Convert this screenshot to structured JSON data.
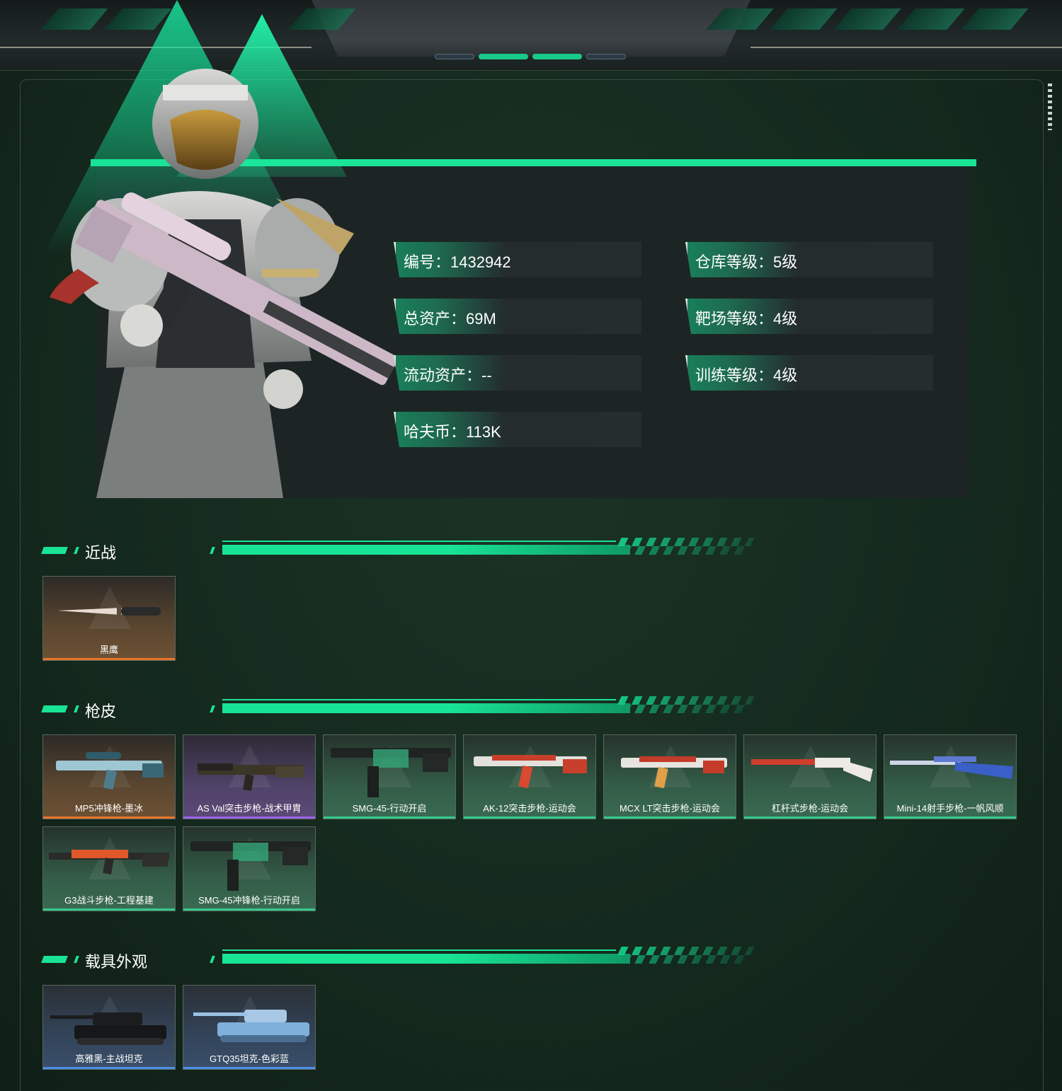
{
  "colors": {
    "accent": "#19e495",
    "rarity_orange": "#e8742a",
    "rarity_purple": "#9b62e6",
    "rarity_green": "#35c98a",
    "rarity_blue": "#4c8fe6"
  },
  "profile": {
    "stats": [
      {
        "label": "编号：1432942"
      },
      {
        "label": "仓库等级：5级"
      },
      {
        "label": "总资产：69M"
      },
      {
        "label": "靶场等级：4级"
      },
      {
        "label": "流动资产：--"
      },
      {
        "label": "训练等级：4级"
      },
      {
        "label": "哈夫币：113K"
      }
    ]
  },
  "sections": {
    "melee": {
      "title": "近战",
      "items": [
        {
          "name": "黑鹰",
          "rarity": "orange",
          "icon": "knife-icon"
        }
      ]
    },
    "gun_skins": {
      "title": "枪皮",
      "items": [
        {
          "name": "MP5冲锋枪-墨冰",
          "rarity": "orange",
          "icon": "smg-icon"
        },
        {
          "name": "AS Val突击步枪-战术甲胄",
          "rarity": "purple",
          "icon": "rifle-icon"
        },
        {
          "name": "SMG-45-行动开启",
          "rarity": "green",
          "icon": "smg-icon"
        },
        {
          "name": "AK-12突击步枪-运动会",
          "rarity": "green",
          "icon": "rifle-icon"
        },
        {
          "name": "MCX LT突击步枪-运动会",
          "rarity": "green",
          "icon": "rifle-icon"
        },
        {
          "name": "杠杆式步枪-运动会",
          "rarity": "green",
          "icon": "rifle-icon"
        },
        {
          "name": "Mini-14射手步枪-一帆风顺",
          "rarity": "green",
          "icon": "rifle-icon"
        },
        {
          "name": "G3战斗步枪-工程基建",
          "rarity": "green",
          "icon": "rifle-icon"
        },
        {
          "name": "SMG-45冲锋枪-行动开启",
          "rarity": "green",
          "icon": "smg-icon"
        }
      ]
    },
    "vehicles": {
      "title": "载具外观",
      "items": [
        {
          "name": "高雅黑-主战坦克",
          "rarity": "blue",
          "icon": "tank-icon"
        },
        {
          "name": "GTQ35坦克-色彩蓝",
          "rarity": "blue",
          "icon": "tank-icon"
        }
      ]
    }
  }
}
